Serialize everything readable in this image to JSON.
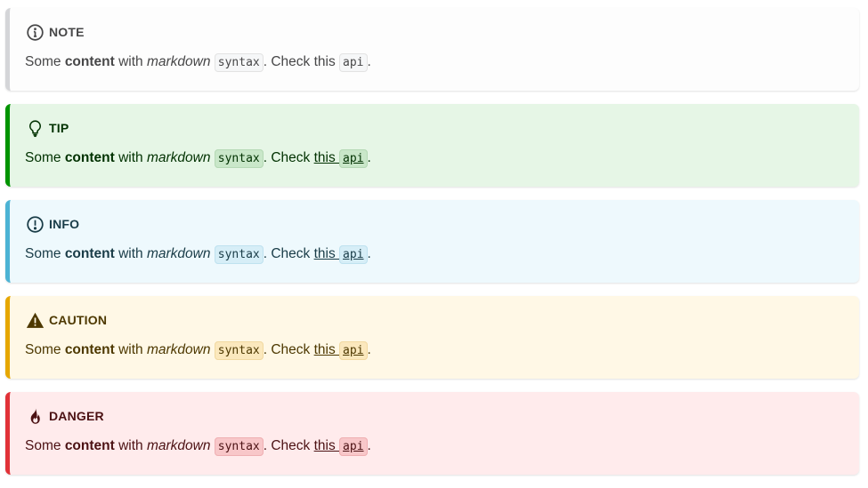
{
  "admonitions": [
    {
      "kind": "note",
      "title": "NOTE",
      "icon": "info-circle-icon",
      "text_before": "Some ",
      "bold": "content",
      "text_with": " with ",
      "italic": "markdown",
      "code1": "syntax",
      "text_check": ". Check this ",
      "code2": "api",
      "text_end": "."
    },
    {
      "kind": "tip",
      "title": "TIP",
      "icon": "lightbulb-icon",
      "text_before": "Some ",
      "bold": "content",
      "text_with": " with ",
      "italic": "markdown",
      "code1": "syntax",
      "text_check": ". Check ",
      "link": "this ",
      "code2": "api",
      "text_end": "."
    },
    {
      "kind": "info",
      "title": "INFO",
      "icon": "exclamation-circle-icon",
      "text_before": "Some ",
      "bold": "content",
      "text_with": " with ",
      "italic": "markdown",
      "code1": "syntax",
      "text_check": ". Check ",
      "link": "this ",
      "code2": "api",
      "text_end": "."
    },
    {
      "kind": "caution",
      "title": "CAUTION",
      "icon": "warning-triangle-icon",
      "text_before": "Some ",
      "bold": "content",
      "text_with": " with ",
      "italic": "markdown",
      "code1": "syntax",
      "text_check": ". Check ",
      "link": "this ",
      "code2": "api",
      "text_end": "."
    },
    {
      "kind": "danger",
      "title": "DANGER",
      "icon": "fire-icon",
      "text_before": "Some ",
      "bold": "content",
      "text_with": " with ",
      "italic": "markdown",
      "code1": "syntax",
      "text_check": ". Check ",
      "link": "this ",
      "code2": "api",
      "text_end": "."
    }
  ],
  "colors": {
    "note_border": "#d4d5d8",
    "tip_border": "#009400",
    "info_border": "#4cb3d4",
    "caution_border": "#e6a700",
    "danger_border": "#e13238"
  }
}
